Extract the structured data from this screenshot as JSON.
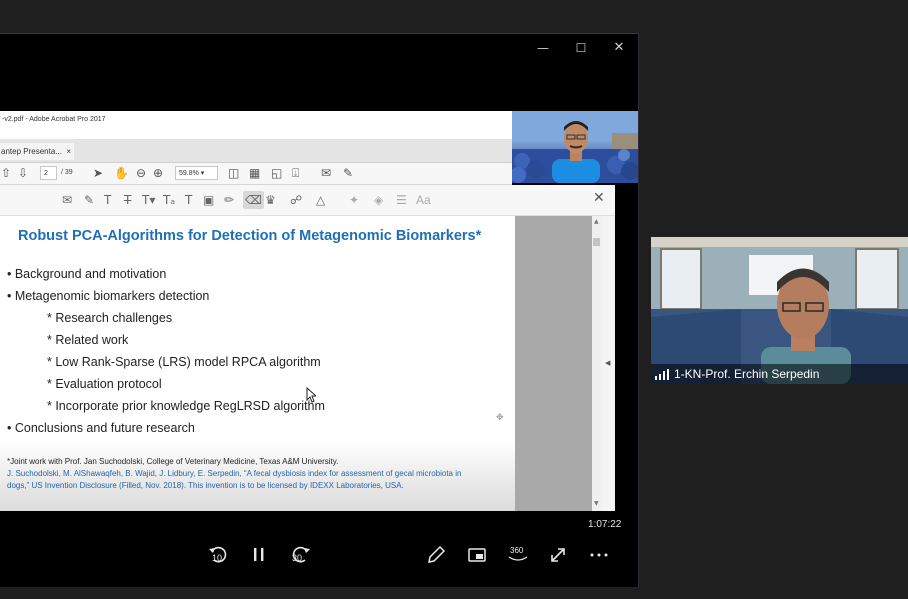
{
  "window": {
    "minimize_icon": "minimize-icon",
    "maximize_icon": "maximize-icon",
    "close_icon": "close-icon"
  },
  "acrobat": {
    "title": "-v2.pdf - Adobe Acrobat Pro 2017",
    "tab_label": "antep Presenta...",
    "tab_close": "×",
    "page_current": "2",
    "page_total": "/ 39",
    "zoom": "59.8%",
    "tools_text_icon": "Aa"
  },
  "slide": {
    "title": "Robust PCA-Algorithms for Detection of Metagenomic Biomarkers*",
    "bullets": [
      "• Background and motivation",
      "• Metagenomic biomarkers detection",
      "* Research challenges",
      "* Related work",
      "* Low Rank-Sparse (LRS) model RPCA algorithm",
      "* Evaluation protocol",
      "* Incorporate prior knowledge RegLRSD algorithm",
      "• Conclusions and future research"
    ],
    "footnote_1": "*Joint work with Prof. Jan Suchodolski, College of Veterinary Medicine, Texas A&M University.",
    "footnote_2": "J. Suchodolski, M. AlShawaqfeh, B. Wajid, J. Lidbury, E. Serpedin, “A fecal dysbiosis index for assessment of gecal microbiota in",
    "footnote_3": "dogs,” US Invention Disclosure (Filled, Nov. 2018). This invention is to be licensed by IDEXX Laboratories, USA."
  },
  "playback": {
    "time": "1:07:22",
    "rewind_label": "10",
    "forward_label": "30",
    "vr_label": "360"
  },
  "participant": {
    "name": "1-KN-Prof. Erchin Serpedin"
  },
  "colors": {
    "slide_title": "#1f6fb6",
    "footnote_blue": "#2a63a8",
    "background": "#1f1f1f"
  }
}
